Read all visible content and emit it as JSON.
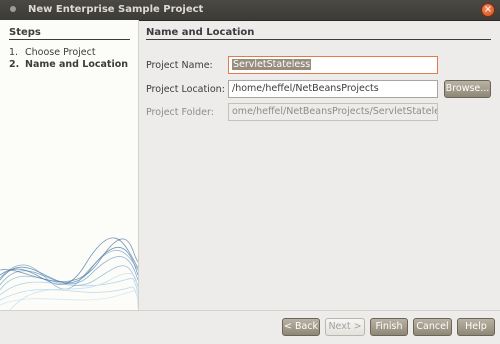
{
  "window": {
    "title": "New Enterprise Sample Project",
    "close_icon": "×"
  },
  "steps": {
    "title": "Steps",
    "items": [
      {
        "number": "1.",
        "label": "Choose Project",
        "current": false
      },
      {
        "number": "2.",
        "label": "Name and Location",
        "current": true
      }
    ]
  },
  "panel": {
    "title": "Name and Location",
    "fields": {
      "project_name": {
        "label": "Project Name:",
        "value": "ServletStateless"
      },
      "project_location": {
        "label": "Project Location:",
        "value": "/home/heffel/NetBeansProjects"
      },
      "project_folder": {
        "label": "Project Folder:",
        "value": "ome/heffel/NetBeansProjects/ServletStateless"
      }
    },
    "browse_label": "Browse..."
  },
  "buttons": {
    "back": "< Back",
    "next": "Next >",
    "finish": "Finish",
    "cancel": "Cancel",
    "help": "Help"
  },
  "colors": {
    "titlebar": "#3c3b37",
    "dialog_bg": "#edeceb",
    "steps_bg": "#fcfcf8",
    "button": "#a29a8a",
    "focus_border": "#e27a4f",
    "close_button": "#e2622b"
  }
}
